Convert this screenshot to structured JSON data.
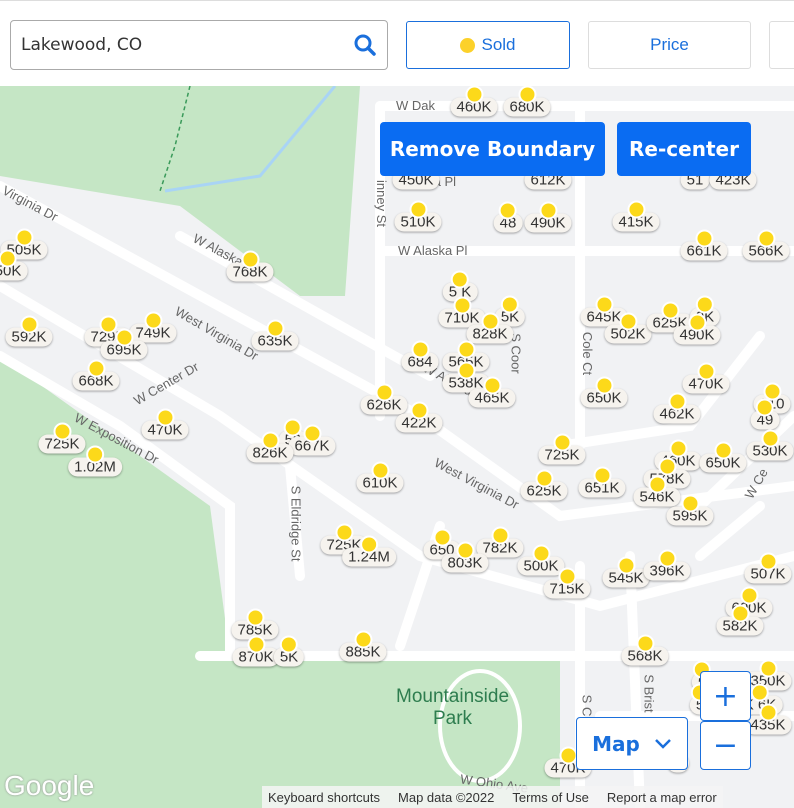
{
  "search": {
    "value": "Lakewood, CO",
    "icon": "search-icon"
  },
  "filters": [
    {
      "label": "Sold",
      "dot_color": "#fcd12a",
      "active": true
    },
    {
      "label": "Price",
      "active": false
    },
    {
      "label": "",
      "active": false
    }
  ],
  "map": {
    "remove_boundary": "Remove Boundary",
    "recenter": "Re-center",
    "map_type": "Map",
    "zoom_in": "+",
    "zoom_out": "−",
    "park_name": [
      "Mountainside",
      "Park"
    ],
    "streets": [
      "W Dak",
      "W Alaska Pl",
      "W Alaska Pl",
      "Virginia Dr",
      "West Virginia Dr",
      "W Center Dr",
      "W Exposition Dr",
      "West Virginia Dr",
      "W Alaska Dr",
      "S Eldridge St",
      "Cole Ct",
      "S Coor",
      "S Brist",
      "S C",
      "W Ohio Ave",
      "inney St",
      "ta Pl",
      "W Ce"
    ],
    "markers": [
      "460K",
      "680K",
      "450K",
      "612K",
      "51",
      "423K",
      "510K",
      "48",
      "490K",
      "415K",
      "505K",
      "50K",
      "768K",
      "661K",
      "566K",
      "5 K",
      "710K",
      "5K",
      "828K",
      "645K",
      "502K",
      "625K",
      "9K",
      "490K",
      "592K",
      "729K",
      "749K",
      "695K",
      "635K",
      "684",
      "565K",
      "538K",
      "465K",
      "668K",
      "470K",
      "626K",
      "422K",
      "650K",
      "462K",
      "610",
      "49",
      "470K",
      "725K",
      "59",
      "667K",
      "826K",
      "1.02M",
      "725K",
      "460K",
      "650K",
      "530K",
      "610K",
      "578K",
      "546K",
      "625K",
      "651K",
      "595K",
      "725K",
      "1.24M",
      "650",
      "782K",
      "803K",
      "500K",
      "715K",
      "545K",
      "396K",
      "507K",
      "600K",
      "582K",
      "785K",
      "870K",
      "5K",
      "885K",
      "568K",
      "350K",
      "5",
      "5",
      "K 6K",
      "435K",
      "470K",
      "K"
    ],
    "sold_color": "#fcd91a",
    "accent": "#0a6cf2"
  },
  "footer": {
    "logo": "Google",
    "links": [
      "Keyboard shortcuts",
      "Map data ©2022",
      "Terms of Use",
      "Report a map error"
    ]
  }
}
